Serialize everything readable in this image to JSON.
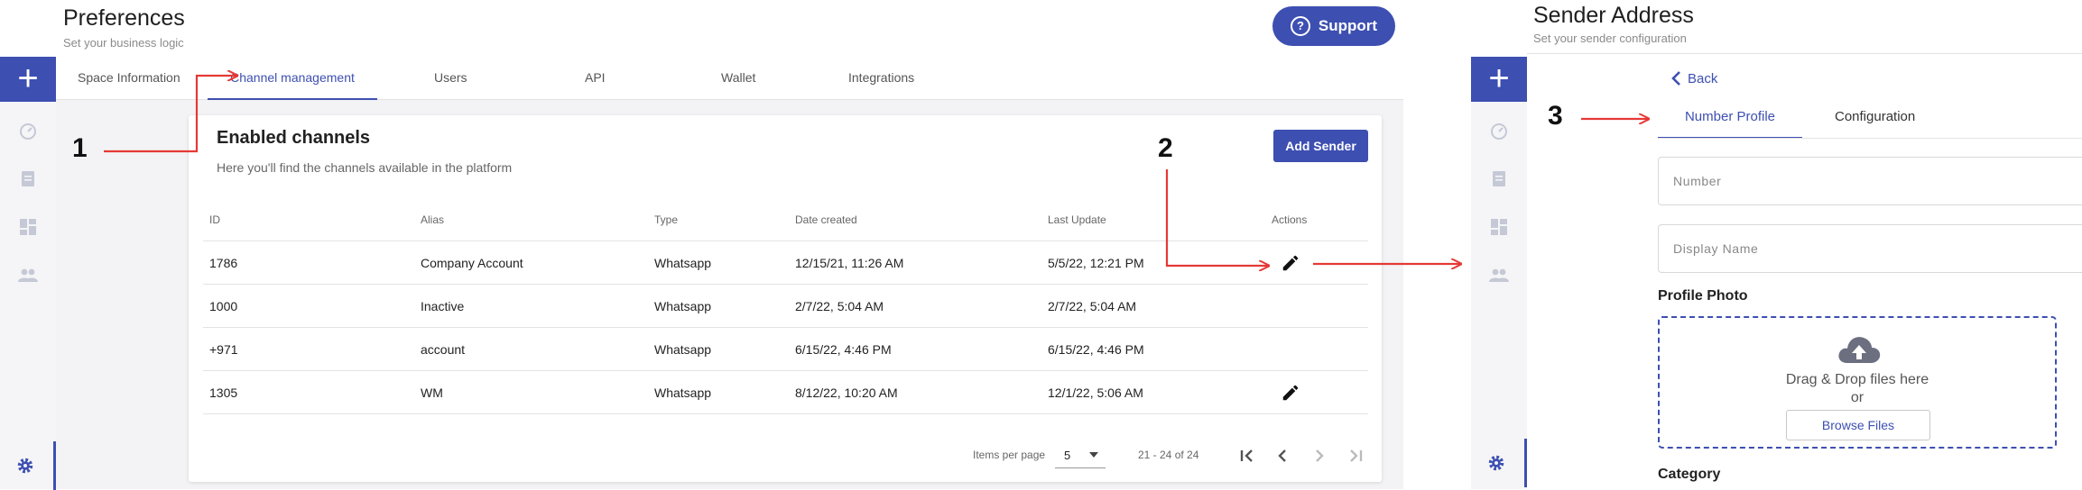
{
  "left": {
    "header": {
      "title": "Preferences",
      "subtitle": "Set your business logic",
      "support_label": "Support"
    },
    "rail": {
      "add": "+",
      "icons": [
        "dashboard-icon",
        "clipboard-icon",
        "widgets-icon",
        "people-icon"
      ],
      "settings": "gear-icon"
    },
    "tabs": [
      {
        "label": "Space Information"
      },
      {
        "label": "Channel management"
      },
      {
        "label": "Users"
      },
      {
        "label": "API"
      },
      {
        "label": "Wallet"
      },
      {
        "label": "Integrations"
      }
    ],
    "card": {
      "title": "Enabled channels",
      "subtitle": "Here you'll find the channels available in the platform",
      "add_label": "Add Sender",
      "columns": [
        "ID",
        "Alias",
        "Type",
        "Date created",
        "Last Update",
        "Actions"
      ],
      "rows": [
        {
          "id": "1786",
          "alias": "Company Account",
          "type": "Whatsapp",
          "created": "12/15/21, 11:26 AM",
          "updated": "5/5/22, 12:21 PM",
          "editable": true
        },
        {
          "id": "1000",
          "alias": "Inactive",
          "type": "Whatsapp",
          "created": "2/7/22, 5:04 AM",
          "updated": "2/7/22, 5:04 AM",
          "editable": false
        },
        {
          "id": "+971",
          "alias": "account",
          "type": "Whatsapp",
          "created": "6/15/22, 4:46 PM",
          "updated": "6/15/22, 4:46 PM",
          "editable": false
        },
        {
          "id": "1305",
          "alias": "WM",
          "type": "Whatsapp",
          "created": "8/12/22, 10:20 AM",
          "updated": "12/1/22, 5:06 AM",
          "editable": true
        }
      ],
      "pager": {
        "items_label": "Items per page",
        "per_page": "5",
        "range": "21 - 24 of 24"
      }
    }
  },
  "annotations": {
    "one": "1",
    "two": "2",
    "three": "3"
  },
  "right": {
    "header": {
      "title": "Sender Address",
      "subtitle": "Set your sender configuration"
    },
    "back_label": "Back",
    "tabs": [
      {
        "label": "Number Profile"
      },
      {
        "label": "Configuration"
      }
    ],
    "fields": {
      "number": "Number",
      "display_name": "Display Name"
    },
    "profile_photo": {
      "label": "Profile Photo",
      "drag_text": "Drag & Drop files here",
      "or_text": "or",
      "browse_label": "Browse Files"
    },
    "category_label": "Category"
  },
  "colors": {
    "accent": "#3d4fb1",
    "arrow": "#e53935"
  }
}
